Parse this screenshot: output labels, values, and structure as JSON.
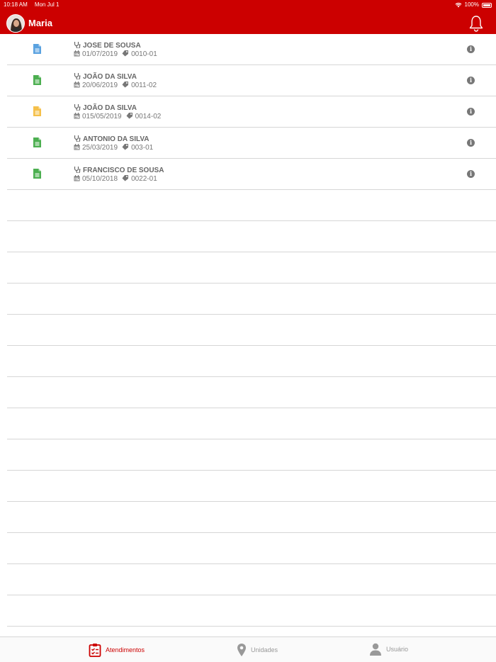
{
  "status_bar": {
    "time": "10:18 AM",
    "date": "Mon Jul 1",
    "battery": "100%"
  },
  "header": {
    "user_name": "Maria"
  },
  "colors": {
    "brand": "#cc0000",
    "blue": "#5aa2e0",
    "green": "#4caf50",
    "yellow": "#f5c04a"
  },
  "records": [
    {
      "name": "JOSE DE SOUSA",
      "date": "01/07/2019",
      "code": "0010-01",
      "doc_color": "#5aa2e0",
      "doc_icon": "document-icon"
    },
    {
      "name": "JOÃO DA SILVA",
      "date": "20/06/2019",
      "code": "0011-02",
      "doc_color": "#4caf50",
      "doc_icon": "document-icon"
    },
    {
      "name": "JOÃO DA SILVA",
      "date": "015/05/2019",
      "code": "0014-02",
      "doc_color": "#f5c04a",
      "doc_icon": "document-icon"
    },
    {
      "name": "ANTONIO DA SILVA",
      "date": "25/03/2019",
      "code": "003-01",
      "doc_color": "#4caf50",
      "doc_icon": "document-icon"
    },
    {
      "name": "FRANCISCO DE SOUSA",
      "date": "05/10/2018",
      "code": "0022-01",
      "doc_color": "#4caf50",
      "doc_icon": "document-icon"
    }
  ],
  "tabs": [
    {
      "label": "Atendimentos",
      "icon": "clipboard-check-icon",
      "active": true
    },
    {
      "label": "Unidades",
      "icon": "map-marker-icon",
      "active": false
    },
    {
      "label": "Usuário",
      "icon": "user-icon",
      "active": false
    }
  ]
}
